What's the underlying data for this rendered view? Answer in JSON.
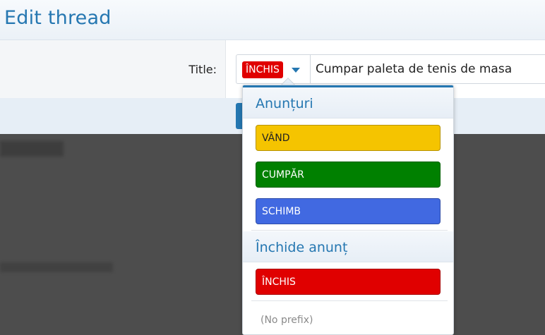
{
  "dialog": {
    "title": "Edit thread",
    "title_label": "Title:",
    "prefix": {
      "label": "ÎNCHIS",
      "color": "#e00000"
    },
    "title_value": "Cumpar paleta de tenis de masa"
  },
  "menu": {
    "groups": [
      {
        "title": "Anunțuri",
        "options": [
          {
            "label": "VÂND",
            "bg": "#f5c400",
            "fg": "#222222"
          },
          {
            "label": "CUMPĂR",
            "bg": "#008000",
            "fg": "#ffffff"
          },
          {
            "label": "SCHIMB",
            "bg": "#4169e1",
            "fg": "#ffffff"
          }
        ]
      },
      {
        "title": "Închide anunț",
        "options": [
          {
            "label": "ÎNCHIS",
            "bg": "#e00000",
            "fg": "#ffffff"
          }
        ]
      }
    ],
    "no_prefix_label": "(No prefix)"
  },
  "colors": {
    "accent": "#2577b1",
    "overlay": "#4d4d4d"
  }
}
